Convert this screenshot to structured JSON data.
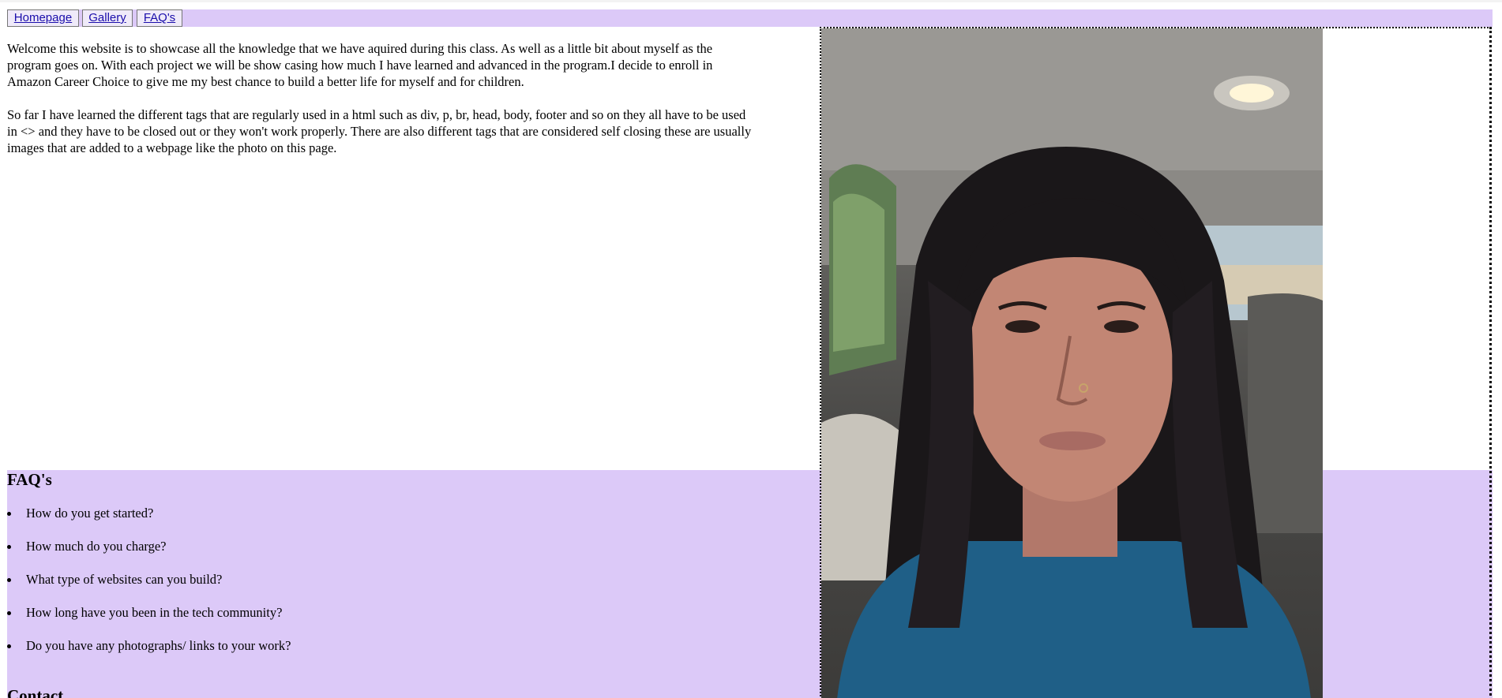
{
  "nav": {
    "items": [
      {
        "label": "Homepage"
      },
      {
        "label": "Gallery"
      },
      {
        "label": "FAQ's"
      }
    ]
  },
  "intro": {
    "paragraphs": [
      "Welcome this website is to showcase all the knowledge that we have aquired during this class. As well as a little bit about myself as the program goes on. With each project we will be show casing how much I have learned and advanced in the program.I decide to enroll in Amazon Career Choice to give me my best chance to build a better life for myself and for children.",
      "So far I have learned the different tags that are regularly used in a html such as div, p, br, head, body, footer and so on they all have to be used in <> and they have to be closed out or they won't work properly. There are also different tags that are considered self closing these are usually images that are added to a webpage like the photo on this page."
    ]
  },
  "faq": {
    "title": "FAQ's",
    "questions": [
      "How do you get started?",
      "How much do you charge?",
      "What type of websites can you build?",
      "How long have you been in the tech community?",
      "Do you have any photographs/ links to your work?"
    ]
  },
  "contact": {
    "title": "Contact"
  },
  "photo": {
    "icon": "portrait-photo"
  },
  "colors": {
    "band": "#dcc9f8",
    "link": "#1a0dab"
  }
}
